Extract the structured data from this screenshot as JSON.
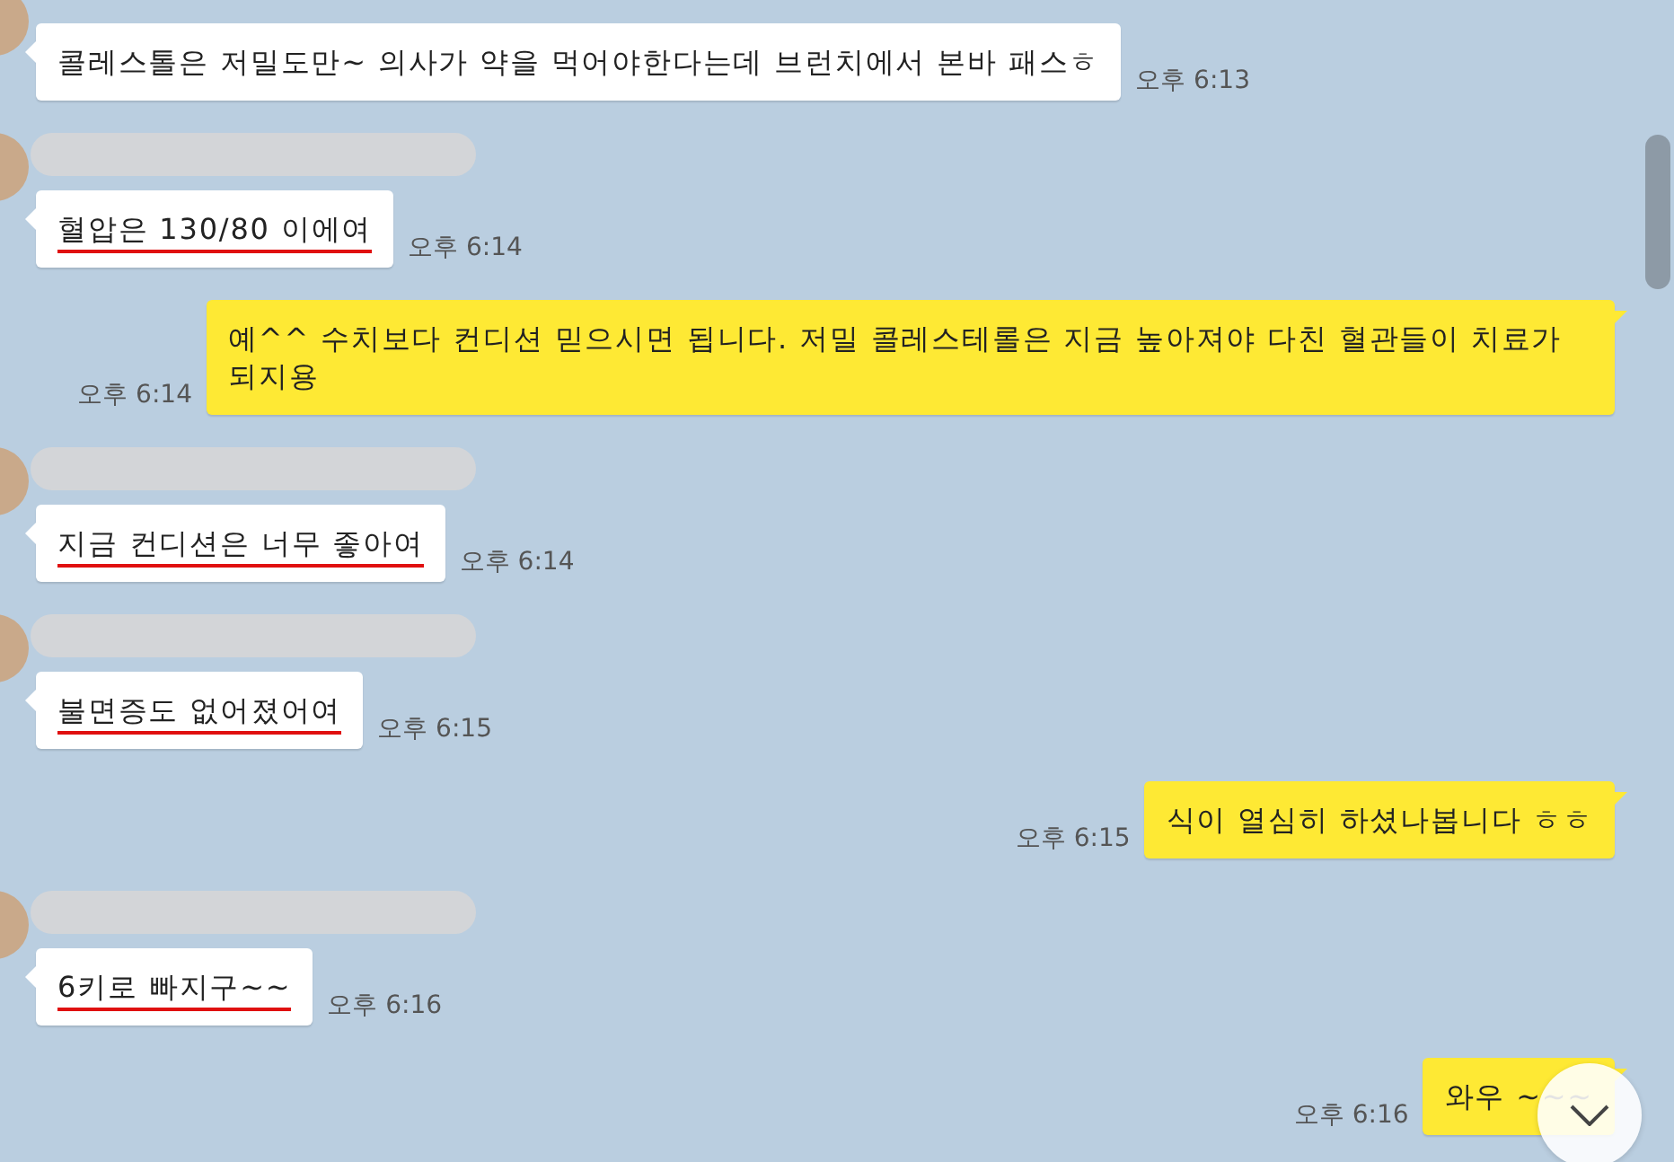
{
  "messages": [
    {
      "kind": "incoming",
      "name_redacted": false,
      "text": "콜레스톨은 저밀도만~ 의사가 약을 먹어야한다는데 브런치에서 본바 패스ㅎ",
      "underlined": false,
      "time": "오후 6:13"
    },
    {
      "kind": "incoming",
      "name_redacted": true,
      "text": "혈압은 130/80 이에여",
      "underlined": true,
      "time": "오후 6:14"
    },
    {
      "kind": "outgoing",
      "text": "예^^ 수치보다 컨디션 믿으시면 됩니다. 저밀 콜레스테롤은 지금 높아져야 다친 혈관들이 치료가 되지용",
      "time": "오후 6:14"
    },
    {
      "kind": "incoming",
      "name_redacted": true,
      "text": "지금 컨디션은 너무 좋아여",
      "underlined": true,
      "time": "오후 6:14"
    },
    {
      "kind": "incoming",
      "name_redacted": true,
      "text": "불면증도 없어졌어여",
      "underlined": true,
      "time": "오후 6:15"
    },
    {
      "kind": "outgoing",
      "text": "식이 열심히 하셨나봅니다 ㅎㅎ",
      "time": "오후 6:15"
    },
    {
      "kind": "incoming",
      "name_redacted": true,
      "text": "6키로 빠지구~~",
      "underlined": true,
      "time": "오후 6:16"
    },
    {
      "kind": "outgoing",
      "text": "와우 ~~~",
      "time": "오후 6:16"
    }
  ]
}
